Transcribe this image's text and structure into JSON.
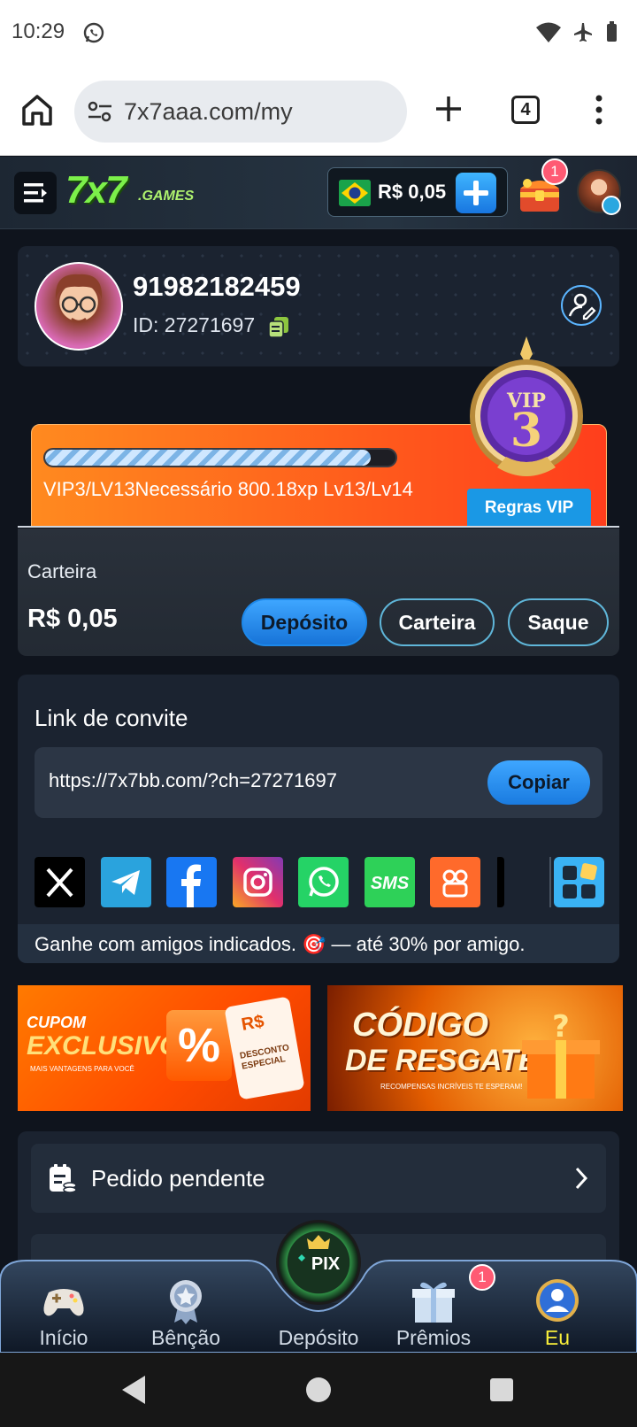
{
  "status_bar": {
    "time": "10:29"
  },
  "browser": {
    "url": "7x7aaa.com/my",
    "tab_count": "4"
  },
  "header": {
    "logo_main": "7x7",
    "logo_suffix": ".GAMES",
    "balance": "R$ 0,05",
    "notification_count": "1"
  },
  "profile": {
    "phone": "91982182459",
    "id_label": "ID: 27271697"
  },
  "vip": {
    "progress": 0.93,
    "text": "VIP3/LV13Necessário 800.18xp Lv13/Lv14",
    "rules_button": "Regras VIP",
    "badge_title": "VIP",
    "badge_level": "3"
  },
  "wallet": {
    "label": "Carteira",
    "amount": "R$ 0,05",
    "deposit_button": "Depósito",
    "wallet_button": "Carteira",
    "withdraw_button": "Saque"
  },
  "invite": {
    "title": "Link de convite",
    "url": "https://7x7bb.com/?ch=27271697",
    "copy_button": "Copiar",
    "footer": "Ganhe com amigos indicados. 🎯 — até 30% por amigo.",
    "share_icons": [
      "x-icon",
      "telegram-icon",
      "facebook-icon",
      "instagram-icon",
      "whatsapp-icon",
      "sms-icon",
      "kwai-icon",
      "more-apps-icon"
    ],
    "sms_text": "SMS"
  },
  "banners": {
    "coupon_line1": "CUPOM",
    "coupon_line2": "EXCLUSIVO",
    "coupon_sub": "MAIS VANTAGENS PARA VOCÊ",
    "coupon_ticket_symbol": "R$",
    "coupon_ticket_text": "DESCONTO ESPECIAL",
    "coupon_percent": "%",
    "redeem_line1": "CÓDIGO",
    "redeem_line2": "DE RESGATE",
    "redeem_sub": "RECOMPENSAS INCRÍVEIS TE ESPERAM!"
  },
  "menu": {
    "items": [
      {
        "label": "Pedido pendente"
      }
    ]
  },
  "bottom_nav": {
    "items": [
      {
        "label": "Início"
      },
      {
        "label": "Bênção"
      },
      {
        "label": "Depósito"
      },
      {
        "label": "Prêmios"
      },
      {
        "label": "Eu"
      }
    ],
    "prizes_badge": "1",
    "pix_text": "PIX",
    "active_index": 4
  },
  "colors": {
    "accent_blue": "#1a98e5",
    "active_nav": "#f8ee3a",
    "badge_red": "#ff5a73",
    "logo_green": "#7cf04a"
  }
}
